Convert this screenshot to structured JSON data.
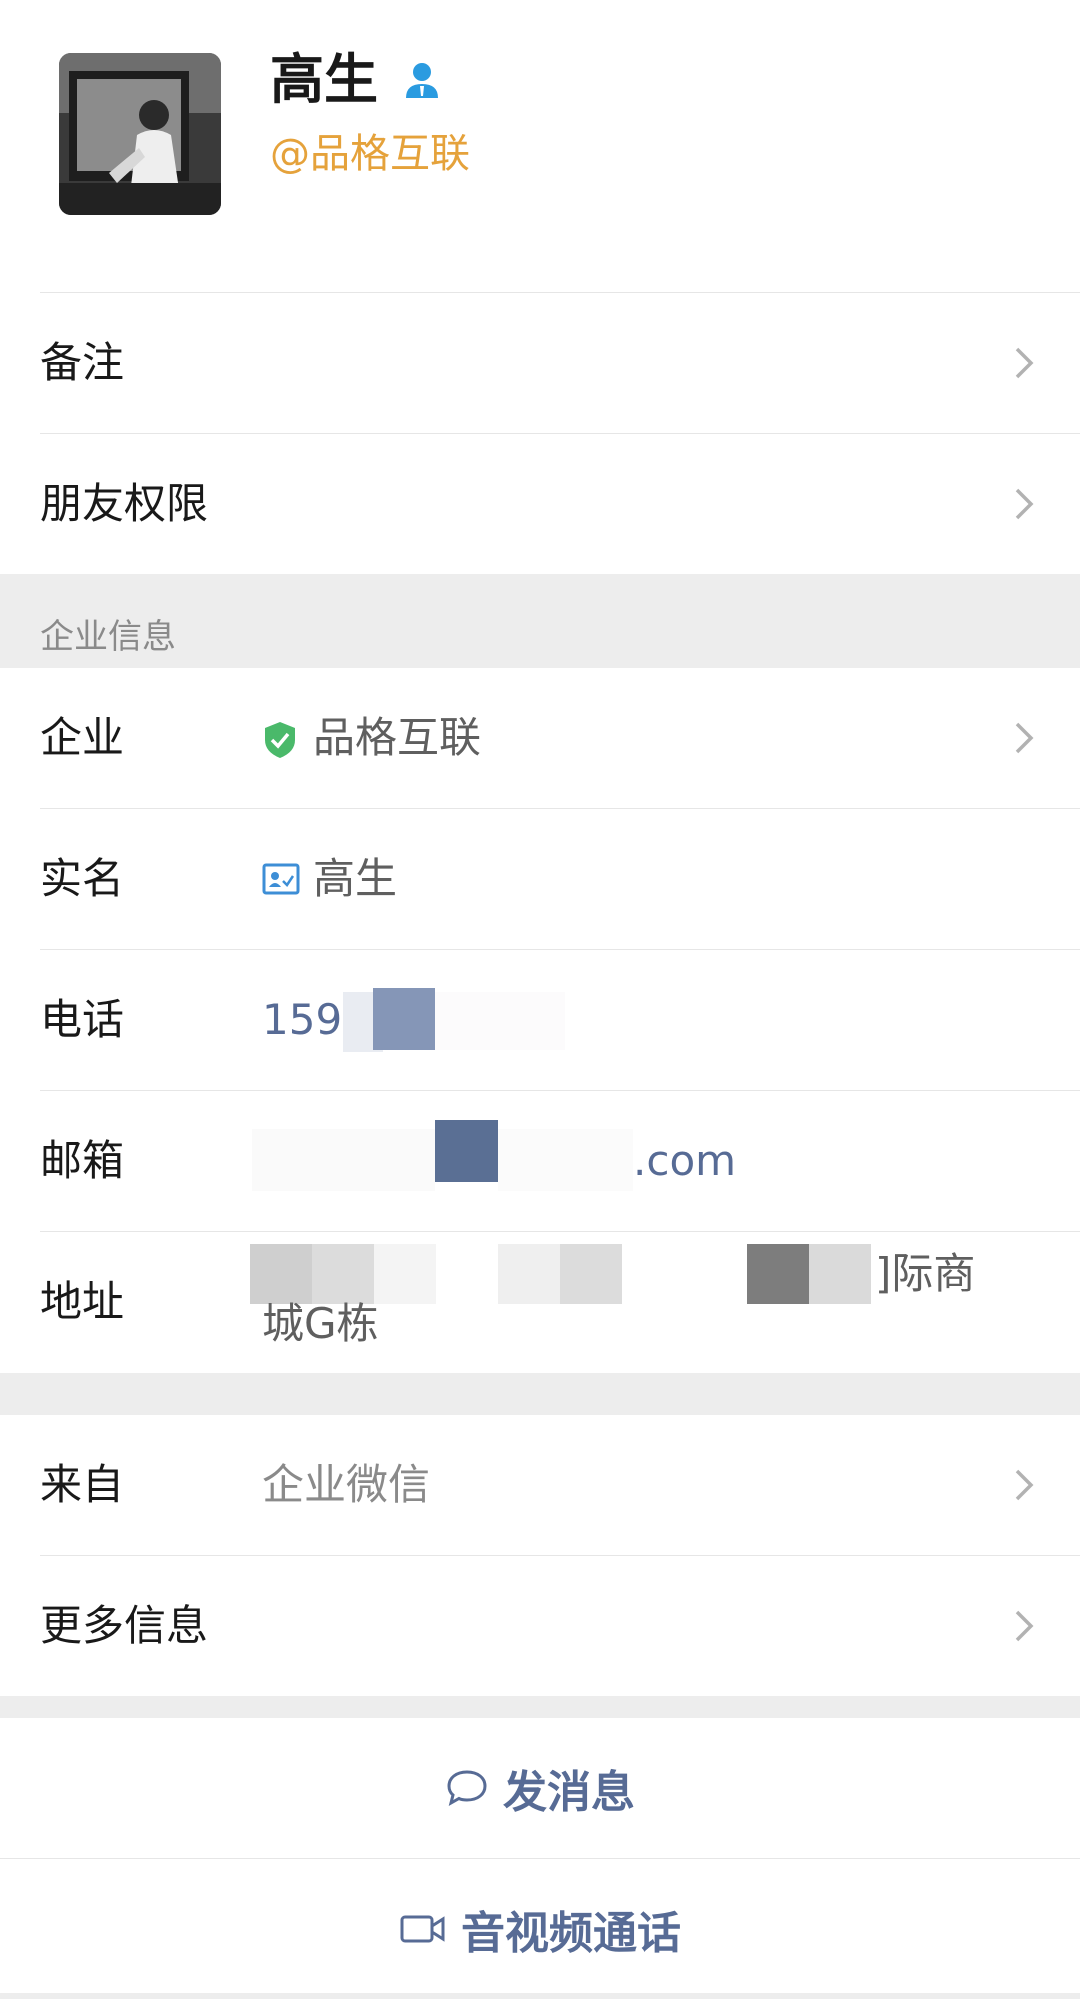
{
  "profile": {
    "name": "高生",
    "handle": "@品格互联"
  },
  "rows_top": [
    {
      "label": "备注"
    },
    {
      "label": "朋友权限"
    }
  ],
  "section_title": "企业信息",
  "company": {
    "enterprise": {
      "label": "企业",
      "value": "品格互联"
    },
    "realname": {
      "label": "实名",
      "value": "高生"
    },
    "phone": {
      "label": "电话",
      "value": "159("
    },
    "email": {
      "label": "邮箱",
      "value": ".com"
    },
    "address": {
      "label": "地址",
      "value_line1": "]际商",
      "value_line2": "城G栋"
    }
  },
  "rows_bottom": [
    {
      "label": "来自",
      "value": "企业微信"
    },
    {
      "label": "更多信息"
    }
  ],
  "actions": {
    "message": "发消息",
    "call": "音视频通话"
  },
  "colors": {
    "accent_blue": "#576b95",
    "handle_orange": "#e5a23b",
    "verified_green": "#4ab96a"
  }
}
